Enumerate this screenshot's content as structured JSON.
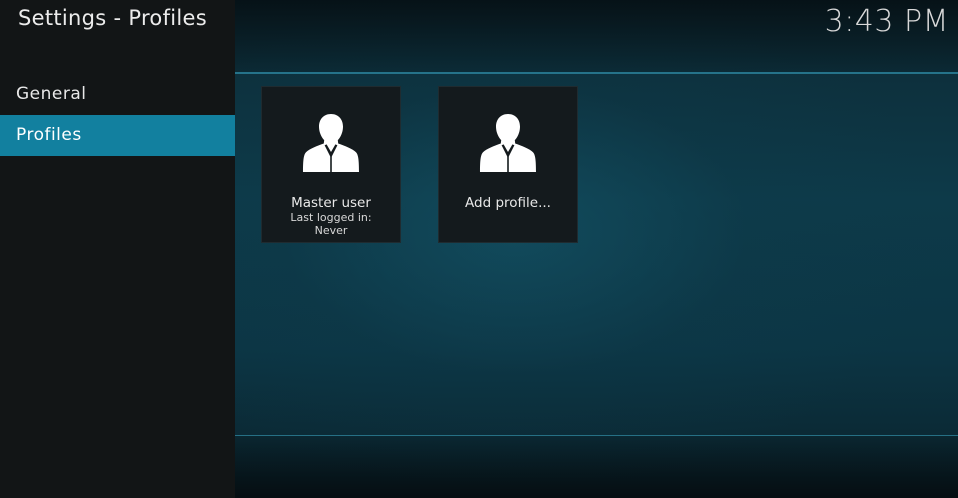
{
  "header": {
    "title": "Settings - Profiles",
    "clock": "3:43 PM"
  },
  "sidebar": {
    "items": [
      {
        "label": "General",
        "selected": false
      },
      {
        "label": "Profiles",
        "selected": true
      }
    ]
  },
  "profiles": [
    {
      "name": "Master user",
      "last_logged_label": "Last logged in:",
      "last_logged_value": "Never",
      "icon": "user-silhouette-icon"
    },
    {
      "name": "Add profile...",
      "icon": "user-silhouette-icon"
    }
  ],
  "colors": {
    "accent": "#12809f",
    "sidebar_bg": "#121516",
    "tile_bg": "#141a1d",
    "divider": "#2a7f98"
  }
}
